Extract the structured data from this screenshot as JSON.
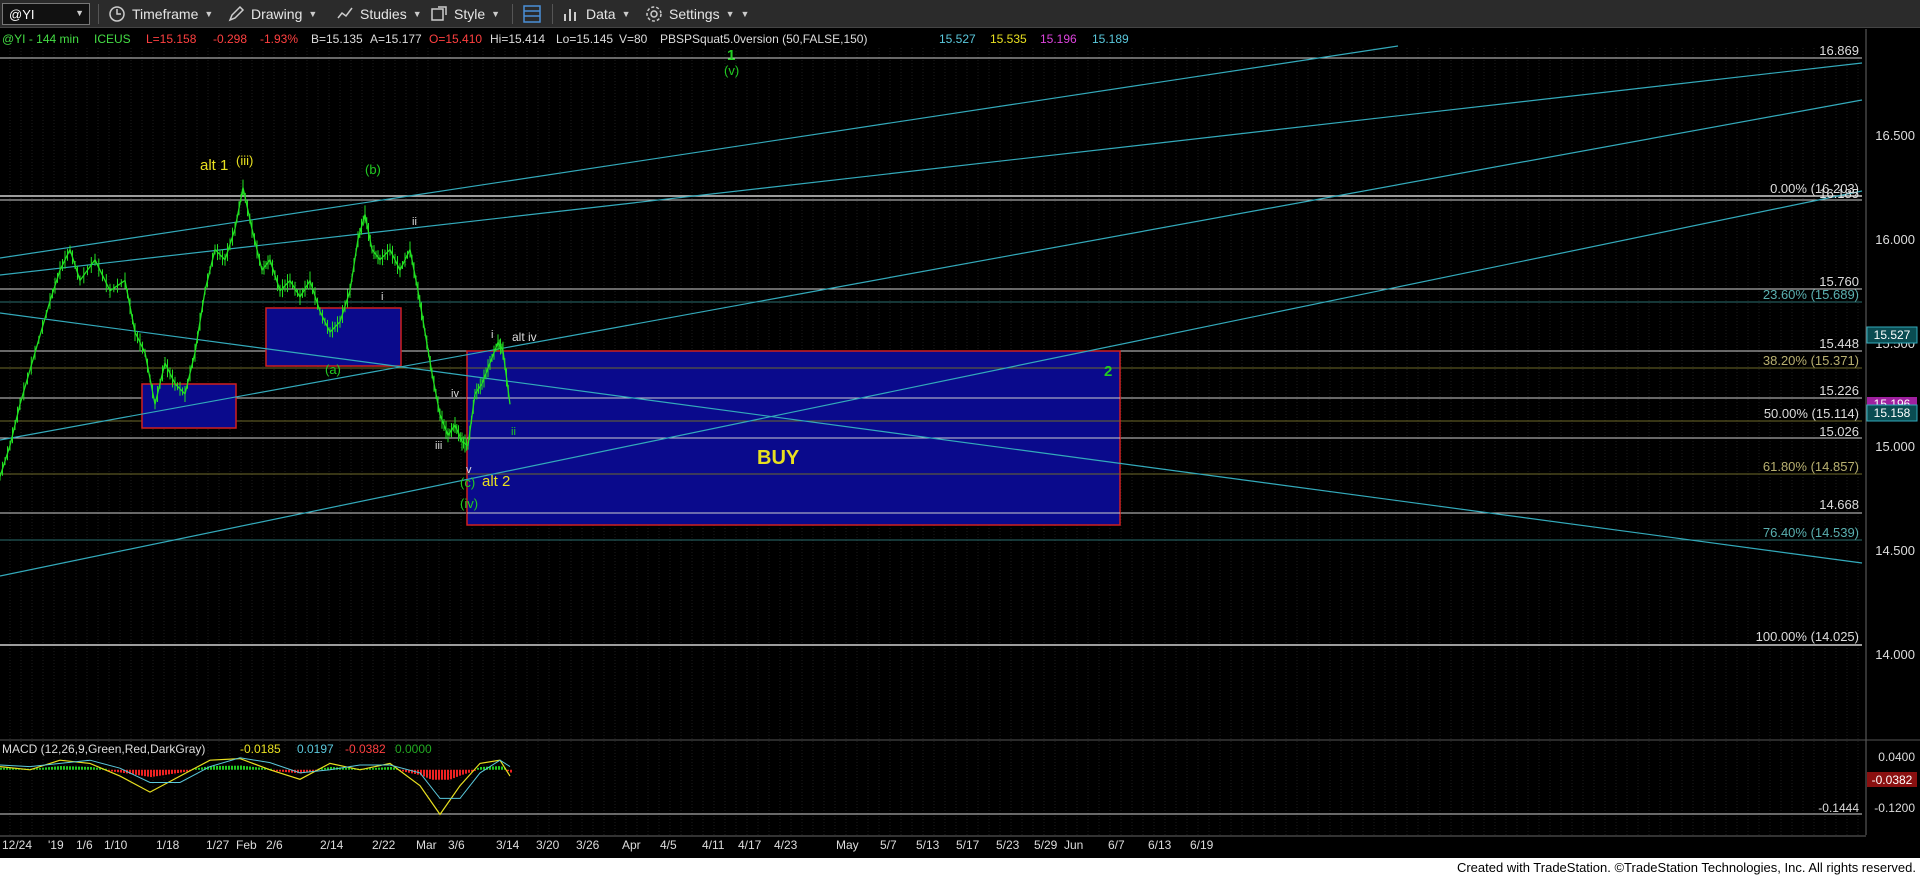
{
  "toolbar": {
    "symbol": "@YI",
    "timeframe": "Timeframe",
    "drawing": "Drawing",
    "studies": "Studies",
    "style": "Style",
    "data": "Data",
    "settings": "Settings"
  },
  "header": {
    "symbol": "@YI - 144 min",
    "exchange": "ICEUS",
    "last": "L=15.158",
    "change": "-0.298",
    "change_pct": "-1.93%",
    "bid": "B=15.135",
    "ask": "A=15.177",
    "open": "O=15.410",
    "high": "Hi=15.414",
    "low": "Lo=15.145",
    "volume": "V=80",
    "study": "PBSPSquat5.0version (50,FALSE,150)",
    "study_values": [
      "15.527",
      "15.535",
      "15.196",
      "15.189"
    ]
  },
  "price_axis": {
    "ticks": [
      "16.500",
      "16.000",
      "15.500",
      "15.000",
      "14.500",
      "14.000"
    ],
    "line_labels": [
      "16.869",
      "16.185",
      "15.760",
      "15.448",
      "15.226",
      "15.026",
      "14.668"
    ],
    "fib_labels": [
      "0.00% (16.203)",
      "23.60% (15.689)",
      "38.20% (15.371)",
      "50.00% (15.114)",
      "61.80% (14.857)",
      "76.40% (14.539)",
      "100.00% (14.025)"
    ],
    "badges": [
      "15.527",
      "15.196",
      "15.158"
    ]
  },
  "macd": {
    "title": "MACD (12,26,9,Green,Red,DarkGray)",
    "values": [
      "-0.0185",
      "0.0197",
      "-0.0382",
      "0.0000"
    ],
    "axis_ticks": [
      "0.0400",
      "-0.1200"
    ],
    "badge": "-0.0382",
    "low_label": "-0.1444"
  },
  "date_axis": [
    "12/24",
    "'19",
    "1/6",
    "1/10",
    "1/18",
    "1/27",
    "Feb",
    "2/6",
    "2/14",
    "2/22",
    "Mar",
    "3/6",
    "3/14",
    "3/20",
    "3/26",
    "Apr",
    "4/5",
    "4/11",
    "4/17",
    "4/23",
    "May",
    "5/7",
    "5/13",
    "5/17",
    "5/23",
    "5/29",
    "Jun",
    "6/7",
    "6/13",
    "6/19"
  ],
  "wave_labels": {
    "alt1": "alt 1",
    "iii_paren": "(iii)",
    "b_paren": "(b)",
    "one": "1",
    "v_paren": "(v)",
    "ii_top": "ii",
    "i_mid": "i",
    "a_paren": "(a)",
    "i_small": "i",
    "alt_iv": "alt iv",
    "iv": "iv",
    "ii_small": "ii",
    "iii_small": "iii",
    "v_small": "v",
    "c_paren": "(c)",
    "alt2": "alt 2",
    "iv_paren": "(iv)",
    "two": "2",
    "buy": "BUY"
  },
  "footer": "Created with TradeStation. ©TradeStation Technologies, Inc. All rights reserved.",
  "colors": {
    "price_bars": "#22e022",
    "trend": "#33aabb",
    "box_fill": "#0a0a8c",
    "box_border": "#d02020",
    "wave_green": "#22cc22",
    "wave_yellow": "#e8e020",
    "fib": "#cccc88"
  },
  "price_series": [
    [
      0,
      14.85
    ],
    [
      10,
      15.0
    ],
    [
      20,
      15.2
    ],
    [
      35,
      15.45
    ],
    [
      50,
      15.7
    ],
    [
      60,
      15.85
    ],
    [
      70,
      15.95
    ],
    [
      80,
      15.8
    ],
    [
      95,
      15.9
    ],
    [
      110,
      15.75
    ],
    [
      125,
      15.8
    ],
    [
      135,
      15.55
    ],
    [
      145,
      15.45
    ],
    [
      155,
      15.2
    ],
    [
      165,
      15.4
    ],
    [
      175,
      15.3
    ],
    [
      185,
      15.25
    ],
    [
      195,
      15.45
    ],
    [
      205,
      15.75
    ],
    [
      215,
      15.95
    ],
    [
      225,
      15.9
    ],
    [
      235,
      16.05
    ],
    [
      243,
      16.25
    ],
    [
      252,
      16.05
    ],
    [
      262,
      15.85
    ],
    [
      270,
      15.9
    ],
    [
      280,
      15.75
    ],
    [
      290,
      15.8
    ],
    [
      300,
      15.72
    ],
    [
      310,
      15.8
    ],
    [
      320,
      15.65
    ],
    [
      330,
      15.55
    ],
    [
      340,
      15.6
    ],
    [
      350,
      15.75
    ],
    [
      358,
      16.0
    ],
    [
      365,
      16.12
    ],
    [
      372,
      15.95
    ],
    [
      380,
      15.9
    ],
    [
      390,
      15.95
    ],
    [
      400,
      15.85
    ],
    [
      410,
      15.95
    ],
    [
      418,
      15.75
    ],
    [
      425,
      15.55
    ],
    [
      432,
      15.35
    ],
    [
      440,
      15.15
    ],
    [
      448,
      15.05
    ],
    [
      455,
      15.1
    ],
    [
      462,
      15.02
    ],
    [
      468,
      15.0
    ],
    [
      475,
      15.25
    ],
    [
      482,
      15.3
    ],
    [
      490,
      15.4
    ],
    [
      498,
      15.5
    ],
    [
      503,
      15.46
    ],
    [
      510,
      15.2
    ]
  ],
  "macd_series": [
    [
      0,
      0.01
    ],
    [
      30,
      0.0
    ],
    [
      60,
      0.03
    ],
    [
      90,
      0.02
    ],
    [
      120,
      -0.02
    ],
    [
      150,
      -0.07
    ],
    [
      180,
      -0.02
    ],
    [
      210,
      0.03
    ],
    [
      240,
      0.035
    ],
    [
      270,
      0.0
    ],
    [
      300,
      -0.03
    ],
    [
      330,
      0.02
    ],
    [
      360,
      0.0
    ],
    [
      390,
      0.02
    ],
    [
      420,
      -0.05
    ],
    [
      440,
      -0.14
    ],
    [
      460,
      -0.05
    ],
    [
      480,
      0.02
    ],
    [
      500,
      0.03
    ],
    [
      510,
      -0.02
    ]
  ]
}
